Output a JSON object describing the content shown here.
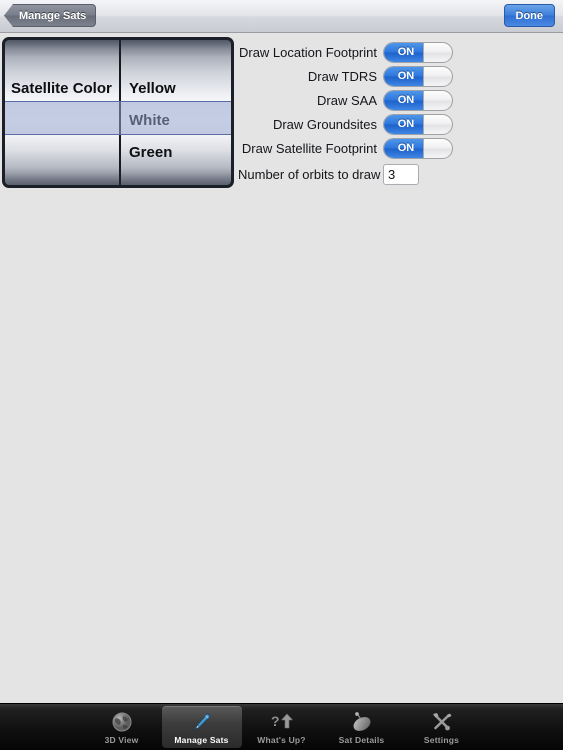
{
  "navbar": {
    "back_label": "Manage Sats",
    "done_label": "Done"
  },
  "picker": {
    "left_column": {
      "rows": [
        "",
        "Satellite Color",
        ""
      ],
      "selected": "Satellite Color"
    },
    "right_column": {
      "rows": [
        "",
        "Yellow",
        "White",
        "Green"
      ],
      "selected": "Yellow"
    }
  },
  "settings": {
    "rows": [
      {
        "label": "Draw Location Footprint",
        "value": "ON",
        "name": "draw-location-footprint"
      },
      {
        "label": "Draw TDRS",
        "value": "ON",
        "name": "draw-tdrs"
      },
      {
        "label": "Draw SAA",
        "value": "ON",
        "name": "draw-saa"
      },
      {
        "label": "Draw Groundsites",
        "value": "ON",
        "name": "draw-groundsites"
      },
      {
        "label": "Draw Satellite Footprint",
        "value": "ON",
        "name": "draw-satellite-footprint"
      }
    ],
    "orbits": {
      "label": "Number of orbits to draw",
      "value": "3",
      "placeholder": ""
    }
  },
  "tabbar": {
    "tabs": [
      {
        "label": "3D View",
        "icon": "globe-icon",
        "selected": false
      },
      {
        "label": "Manage Sats",
        "icon": "pencil-icon",
        "selected": true
      },
      {
        "label": "What's Up?",
        "icon": "question-arrow-icon",
        "selected": false
      },
      {
        "label": "Sat Details",
        "icon": "satellite-dish-icon",
        "selected": false
      },
      {
        "label": "Settings",
        "icon": "tools-icon",
        "selected": false
      }
    ]
  },
  "colors": {
    "accent_blue": "#2f79dd",
    "background": "#e4e4e4",
    "tabbar": "#111111",
    "selection_band": "#96a4cd"
  }
}
